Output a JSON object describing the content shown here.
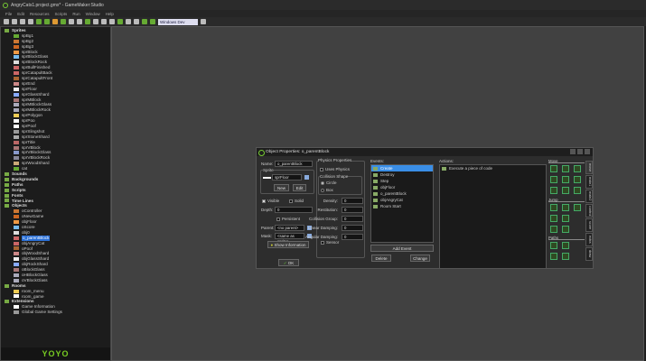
{
  "window": {
    "title": "AngryCats1.project.gmx* - GameMaker:Studio"
  },
  "menu": [
    "File",
    "Edit",
    "Resources",
    "Scripts",
    "Run",
    "Window",
    "Help"
  ],
  "toolbar": {
    "target": "Windows Dev Runner"
  },
  "tree": [
    {
      "label": "Sprites",
      "group": true
    },
    {
      "label": "spBg1"
    },
    {
      "label": "spBg2"
    },
    {
      "label": "spBg3"
    },
    {
      "label": "sprBlock"
    },
    {
      "label": "sprBlockGlass"
    },
    {
      "label": "sprBlockRock"
    },
    {
      "label": "sprBullFinished"
    },
    {
      "label": "sprCatapultBack"
    },
    {
      "label": "sprCatapultFront"
    },
    {
      "label": "sprEnd"
    },
    {
      "label": "sprFloor"
    },
    {
      "label": "sprGlassShard"
    },
    {
      "label": "sprMBlock"
    },
    {
      "label": "sprMBlockGlass"
    },
    {
      "label": "sprMBlockRock"
    },
    {
      "label": "sprPolygon"
    },
    {
      "label": "sprPoo"
    },
    {
      "label": "sprPoof"
    },
    {
      "label": "sprSlingshot"
    },
    {
      "label": "sprStoneShard"
    },
    {
      "label": "sprTitle"
    },
    {
      "label": "sprVBlock"
    },
    {
      "label": "sprVBlockGlass"
    },
    {
      "label": "sprVBlockRock"
    },
    {
      "label": "sprWoodShard"
    },
    {
      "label": "cat"
    },
    {
      "label": "Sounds",
      "group": true
    },
    {
      "label": "Backgrounds",
      "group": true
    },
    {
      "label": "Paths",
      "group": true
    },
    {
      "label": "Scripts",
      "group": true
    },
    {
      "label": "Fonts",
      "group": true
    },
    {
      "label": "Time Lines",
      "group": true
    },
    {
      "label": "Objects",
      "group": true
    },
    {
      "label": "oController"
    },
    {
      "label": "oNewGame"
    },
    {
      "label": "objFloor"
    },
    {
      "label": "oScore"
    },
    {
      "label": "obj0"
    },
    {
      "label": "o_parentBlock",
      "selected": true
    },
    {
      "label": "objAngryCat"
    },
    {
      "label": "oPoof"
    },
    {
      "label": "objWoodShard"
    },
    {
      "label": "objGlassShard"
    },
    {
      "label": "objRockShard"
    },
    {
      "label": "oBlockGlass"
    },
    {
      "label": "oHBlockGlass"
    },
    {
      "label": "oVBlockGlass"
    },
    {
      "label": "Rooms",
      "group": true
    },
    {
      "label": "room_menu"
    },
    {
      "label": "room_game"
    },
    {
      "label": "Extensions",
      "group": true
    },
    {
      "label": "Game Information"
    },
    {
      "label": "Global Game Settings"
    }
  ],
  "logo": "YOYO",
  "dialog": {
    "title": "Object Properties: o_parentBlock",
    "name_label": "Name:",
    "name_value": "o_parentBlock",
    "sprite_label": "Sprite",
    "sprite_value": "sprFloor",
    "new": "New",
    "edit": "Edit",
    "visible": "Visible",
    "solid": "Solid",
    "depth_label": "Depth:",
    "depth_value": "0",
    "persistent": "Persistent",
    "parent_label": "Parent:",
    "parent_value": "<no parent>",
    "mask_label": "Mask:",
    "mask_value": "<same as sprite>",
    "show_info": "Show Information",
    "ok": "OK",
    "physics_title": "Physics Properties",
    "uses_physics": "Uses Physics",
    "collision_shape": "Collision Shape",
    "circle": "Circle",
    "box": "Box",
    "props": [
      {
        "label": "Density:",
        "value": "0"
      },
      {
        "label": "Restitution:",
        "value": "0"
      },
      {
        "label": "Collision Group:",
        "value": "0"
      },
      {
        "label": "Linear Damping:",
        "value": "0"
      },
      {
        "label": "Angular Damping:",
        "value": "0"
      }
    ],
    "sensor": "Sensor",
    "events_title": "Events:",
    "events": [
      "Create",
      "Destroy",
      "Step",
      "objFloor",
      "o_parentBlock",
      "objAngryCat",
      "Room Start"
    ],
    "add_event": "Add Event",
    "delete": "Delete",
    "change": "Change",
    "actions_title": "Actions:",
    "actions": [
      "Execute a piece of code"
    ],
    "sections": [
      "Move",
      "Jump",
      "Paths"
    ],
    "tabs": [
      "move",
      "main1",
      "main2",
      "control",
      "score",
      "extra",
      "draw"
    ]
  }
}
